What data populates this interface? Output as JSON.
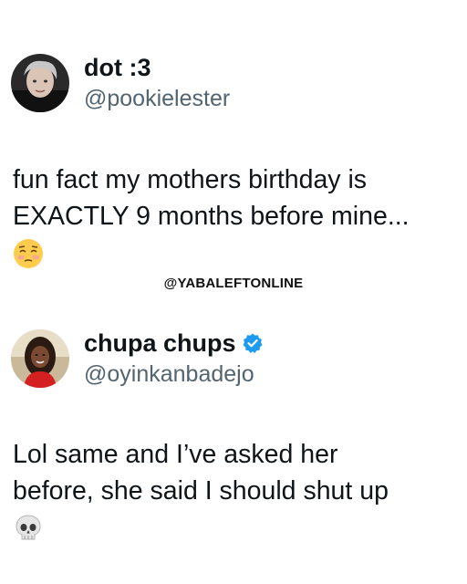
{
  "tweets": [
    {
      "display_name": "dot :3",
      "handle": "@pookielester",
      "verified": false,
      "text_lines": [
        "fun fact my mothers birthday is",
        "EXACTLY 9 months before mine..."
      ],
      "emoji": "flushed-face-emoji"
    },
    {
      "display_name": "chupa chups",
      "handle": "@oyinkanbadejo",
      "verified": true,
      "text_lines": [
        "Lol same and I’ve asked her",
        "before, she said I should shut up"
      ],
      "emoji": "skull-emoji"
    }
  ],
  "watermark": "@YABALEFTONLINE",
  "colors": {
    "text": "#0f1419",
    "handle": "#536471",
    "verified_badge": "#1d9bf0"
  }
}
